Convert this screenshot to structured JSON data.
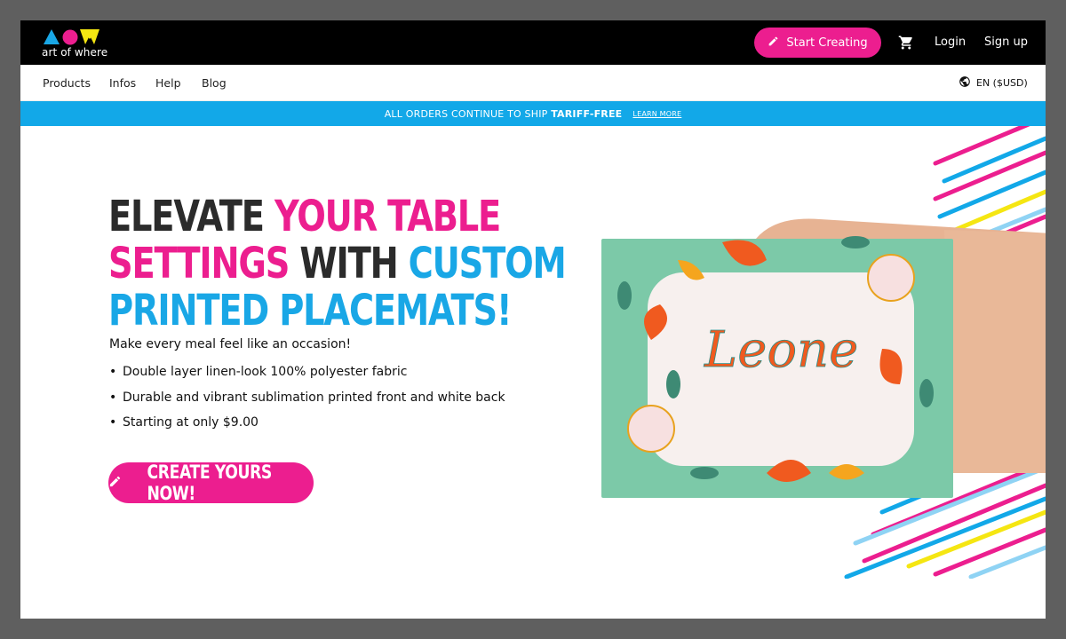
{
  "brand": {
    "logo_text": "art of where"
  },
  "header": {
    "start_creating_label": "Start Creating",
    "login_label": "Login",
    "signup_label": "Sign up"
  },
  "nav": {
    "items": [
      {
        "label": "Products"
      },
      {
        "label": "Infos"
      },
      {
        "label": "Help"
      },
      {
        "label": "Blog"
      }
    ],
    "language_label": "EN ($USD)"
  },
  "banner": {
    "text_pre": "ALL ORDERS CONTINUE TO SHIP",
    "text_bold": "TARIFF-FREE",
    "learn_more_label": "LEARN MORE"
  },
  "hero": {
    "headline": {
      "line1_part1": "ELEVATE ",
      "line1_part2": "YOUR TABLE",
      "line2_part1": "SETTINGS ",
      "line2_part2": "WITH ",
      "line2_part3": "CUSTOM",
      "line3": "PRINTED PLACEMATS!"
    },
    "subline": "Make every meal feel like an occasion!",
    "bullets": [
      "Double layer linen-look 100% polyester fabric",
      "Durable and vibrant sublimation printed front and white back",
      "Starting at only $9.00"
    ],
    "cta_label": "CREATE YOURS NOW!",
    "placemat_text": "Leone"
  },
  "icons": {
    "pencil": "pencil-icon",
    "cart": "cart-icon",
    "globe": "globe-icon"
  },
  "colors": {
    "pink": "#ec1e8f",
    "blue": "#19a7e6",
    "yellow": "#f5e612",
    "black": "#000000",
    "placemat_green": "#7cc9a8"
  }
}
